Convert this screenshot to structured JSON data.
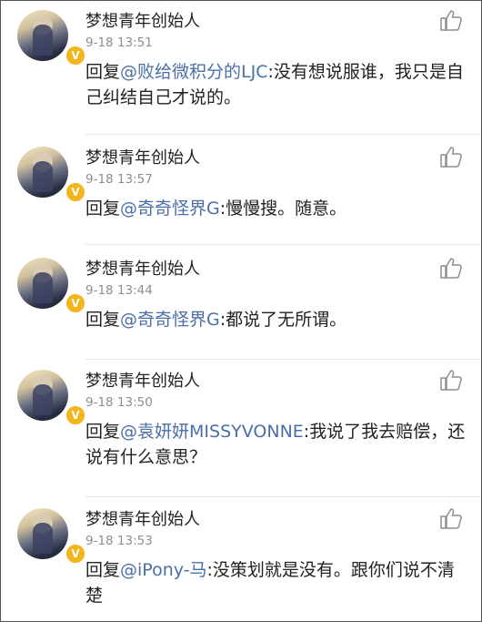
{
  "comments": [
    {
      "name": "梦想青年创始人",
      "time": "9-18 13:51",
      "prefix": "回复",
      "mention": "@败给微积分的LJC",
      "text": ":没有想说服谁，我只是自己纠结自己才说的。"
    },
    {
      "name": "梦想青年创始人",
      "time": "9-18 13:57",
      "prefix": "回复",
      "mention": "@奇奇怪界G",
      "text": ":慢慢搜。随意。"
    },
    {
      "name": "梦想青年创始人",
      "time": "9-18 13:44",
      "prefix": "回复",
      "mention": "@奇奇怪界G",
      "text": ":都说了无所谓。"
    },
    {
      "name": "梦想青年创始人",
      "time": "9-18 13:50",
      "prefix": "回复",
      "mention": "@袁妍妍MISSYVONNE",
      "text": ":我说了我去赔偿，还说有什么意思？"
    },
    {
      "name": "梦想青年创始人",
      "time": "9-18 13:53",
      "prefix": "回复",
      "mention": "@iPony-马",
      "text": ":没策划就是没有。跟你们说不清楚"
    }
  ],
  "badge_label": "V",
  "icons": {
    "like": "thumbs-up-icon",
    "verified": "verified-badge-icon"
  }
}
